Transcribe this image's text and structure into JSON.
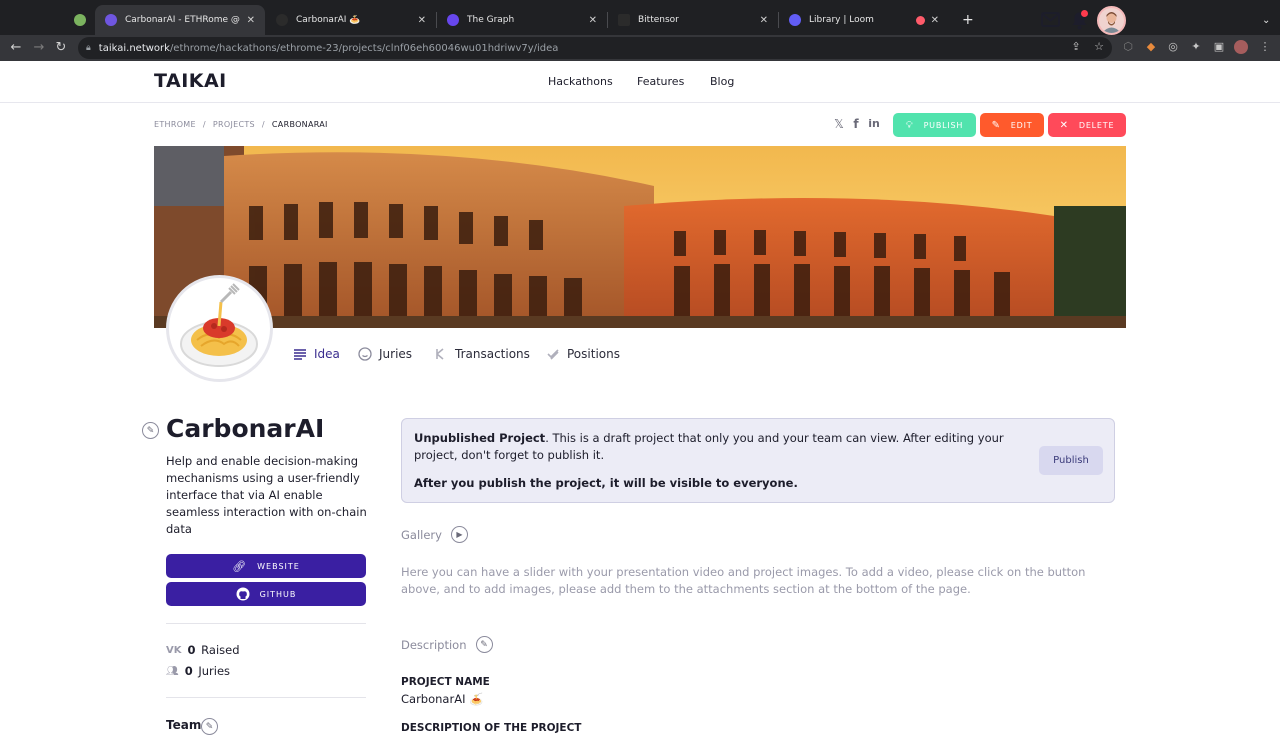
{
  "browser": {
    "tabs": [
      {
        "label": "",
        "favicon_color": "#7bb35f"
      },
      {
        "label": "CarbonarAI - ETHRome @ TAIK",
        "favicon_color": "#6f56e0"
      },
      {
        "label": "CarbonarAI 🍝",
        "favicon_color": "#2b2b2b"
      },
      {
        "label": "The Graph",
        "favicon_color": "#6747ed"
      },
      {
        "label": "Bittensor",
        "favicon_color": "#2b2b2b"
      },
      {
        "label": "Library | Loom",
        "favicon_color": "#625df5"
      }
    ],
    "url_host": "taikai.network",
    "url_path": "/ethrome/hackathons/ethrome-23/projects/clnf06eh60046wu01hdriwv7y/idea"
  },
  "header": {
    "logo": "TAIKAI",
    "nav": [
      "Hackathons",
      "Features",
      "Blog"
    ]
  },
  "breadcrumb": {
    "items": [
      "ETHROME",
      "PROJECTS"
    ],
    "current": "CARBONARAI"
  },
  "actions": {
    "publish": "PUBLISH",
    "edit": "EDIT",
    "delete": "DELETE"
  },
  "tabs": [
    "Idea",
    "Juries",
    "Transactions",
    "Positions"
  ],
  "project": {
    "title": "CarbonarAI",
    "description": "Help and enable decision-making mechanisms using a user-friendly interface that via AI enable seamless interaction with on-chain data",
    "website_label": "WEBSITE",
    "github_label": "GITHUB",
    "raised_value": "0",
    "raised_label": "Raised",
    "juries_value": "0",
    "juries_label": "Juries",
    "team_label": "Team"
  },
  "notice": {
    "bold_lead": "Unpublished Project",
    "text": ". This is a draft project that only you and your team can view. After editing your project, don't forget to publish it.",
    "bold_line": "After you publish the project, it will be visible to everyone.",
    "button": "Publish"
  },
  "gallery": {
    "label": "Gallery",
    "text": "Here you can have a slider with your presentation video and project images. To add a video, please click on the button above, and to add images, please add them to the attachments section at the bottom of the page."
  },
  "description": {
    "label": "Description",
    "project_name_head": "PROJECT NAME",
    "project_name_value": "CarbonarAI 🍝",
    "description_head": "DESCRIPTION OF THE PROJECT"
  },
  "colors": {
    "accent": "#3a1fa2",
    "publish": "#51e3ad",
    "edit": "#ff5a2c",
    "delete": "#ff4a5a"
  }
}
